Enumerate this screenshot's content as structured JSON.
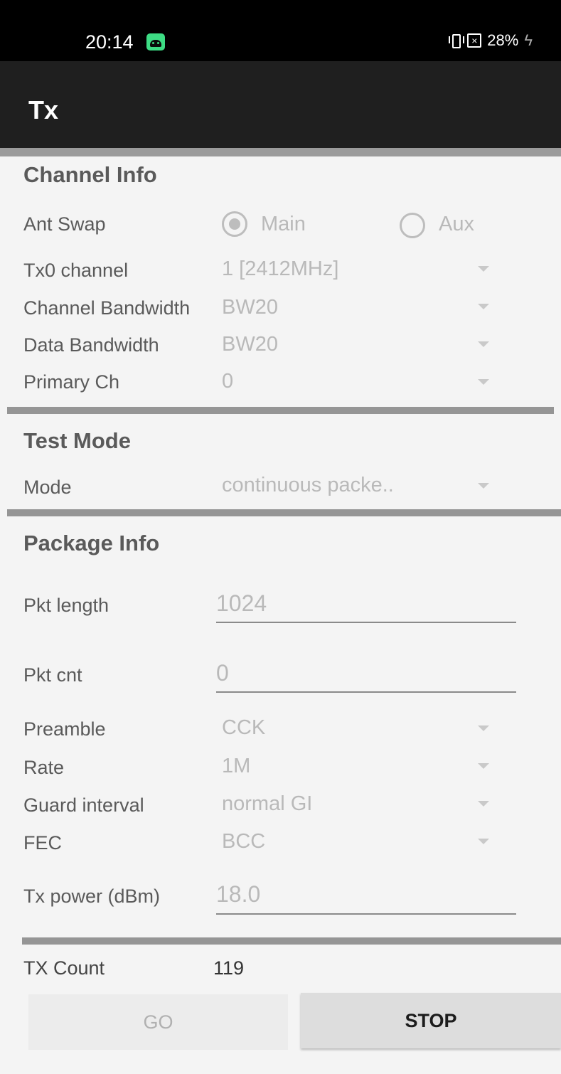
{
  "status_bar": {
    "time": "20:14",
    "battery": "28%"
  },
  "app_bar": {
    "title": "Tx"
  },
  "channel_info": {
    "title": "Channel Info",
    "ant_swap": {
      "label": "Ant Swap",
      "options": [
        "Main",
        "Aux"
      ],
      "selected": "Main"
    },
    "tx0_channel": {
      "label": "Tx0 channel",
      "value": "1 [2412MHz]"
    },
    "channel_bandwidth": {
      "label": "Channel Bandwidth",
      "value": "BW20"
    },
    "data_bandwidth": {
      "label": "Data Bandwidth",
      "value": "BW20"
    },
    "primary_ch": {
      "label": "Primary Ch",
      "value": "0"
    }
  },
  "test_mode": {
    "title": "Test Mode",
    "mode": {
      "label": "Mode",
      "value": "continuous packe.."
    }
  },
  "package_info": {
    "title": "Package Info",
    "pkt_length": {
      "label": "Pkt length",
      "value": "1024"
    },
    "pkt_cnt": {
      "label": "Pkt cnt",
      "value": "0"
    },
    "preamble": {
      "label": "Preamble",
      "value": "CCK"
    },
    "rate": {
      "label": "Rate",
      "value": "1M"
    },
    "guard_interval": {
      "label": "Guard interval",
      "value": "normal GI"
    },
    "fec": {
      "label": "FEC",
      "value": "BCC"
    },
    "tx_power": {
      "label": "Tx power (dBm)",
      "value": "18.0"
    }
  },
  "tx_count": {
    "label": "TX Count",
    "value": "119"
  },
  "buttons": {
    "go": "GO",
    "stop": "STOP"
  }
}
